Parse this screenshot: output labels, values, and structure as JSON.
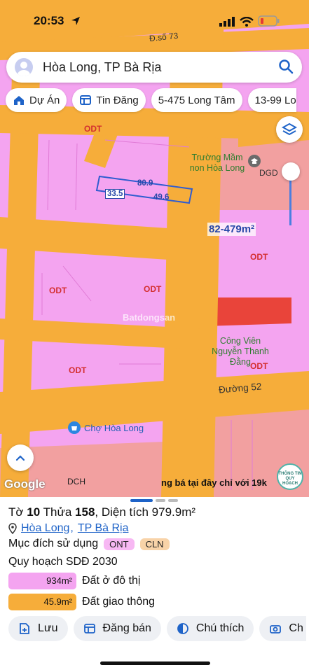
{
  "status_bar": {
    "time": "20:53"
  },
  "search": {
    "value": "Hòa Long, TP Bà Rịa"
  },
  "chips": [
    {
      "label": "Dự Án",
      "icon": "house-icon"
    },
    {
      "label": "Tin Đăng",
      "icon": "listing-icon"
    },
    {
      "label": "5-475 Long Tâm",
      "icon": ""
    },
    {
      "label": "13-99 Lo",
      "icon": ""
    }
  ],
  "map": {
    "zone_labels": [
      "ODT",
      "ODT",
      "ODT",
      "ODT",
      "ODT",
      "ODT",
      "DCH",
      "DGD"
    ],
    "road_labels": [
      "Đ.số 73",
      "Đường 52"
    ],
    "poi": {
      "school": "Trường Mầm non Hòa Long",
      "park": "Công Viên Nguyễn Thanh Đằng",
      "market": "Chợ Hòa Long"
    },
    "dimensions": [
      "80.9",
      "33.5",
      "49.6"
    ],
    "area_range": "82-479m²",
    "ticker": "ng bá tại đây chỉ với 19k",
    "watermark": "Batdongsan",
    "attribution": "Google",
    "badge_text": "THÔNG TIN QUY HOẠCH",
    "colors": {
      "residential": "#f4a4f0",
      "road": "#f6ad3a",
      "water": "#e9443a",
      "facility": "#f2a0a0"
    }
  },
  "sheet": {
    "title_prefix": "Tờ",
    "sheet_no": "10",
    "plot_prefix": "Thửa",
    "plot_no": "158",
    "area_text": ", Diện tích 979.9m²",
    "ward": "Hòa Long",
    "sep": ",",
    "city": "TP Bà Rịa",
    "purpose_label": "Mục đích sử dụng",
    "tags": [
      {
        "code": "ONT",
        "color": "#f7b8f3"
      },
      {
        "code": "CLN",
        "color": "#f8d3a8"
      }
    ],
    "plan_title": "Quy hoạch SDĐ 2030",
    "plans": [
      {
        "area": "934m²",
        "label": "Đất ở đô thị",
        "color": "#f4a4f0"
      },
      {
        "area": "45.9m²",
        "label": "Đất giao thông",
        "color": "#f6ad3a"
      }
    ],
    "actions": [
      {
        "label": "Lưu",
        "icon": "save-icon"
      },
      {
        "label": "Đăng bán",
        "icon": "post-listing-icon"
      },
      {
        "label": "Chú thích",
        "icon": "legend-icon"
      },
      {
        "label": "Ch",
        "icon": "camera-icon"
      }
    ]
  }
}
